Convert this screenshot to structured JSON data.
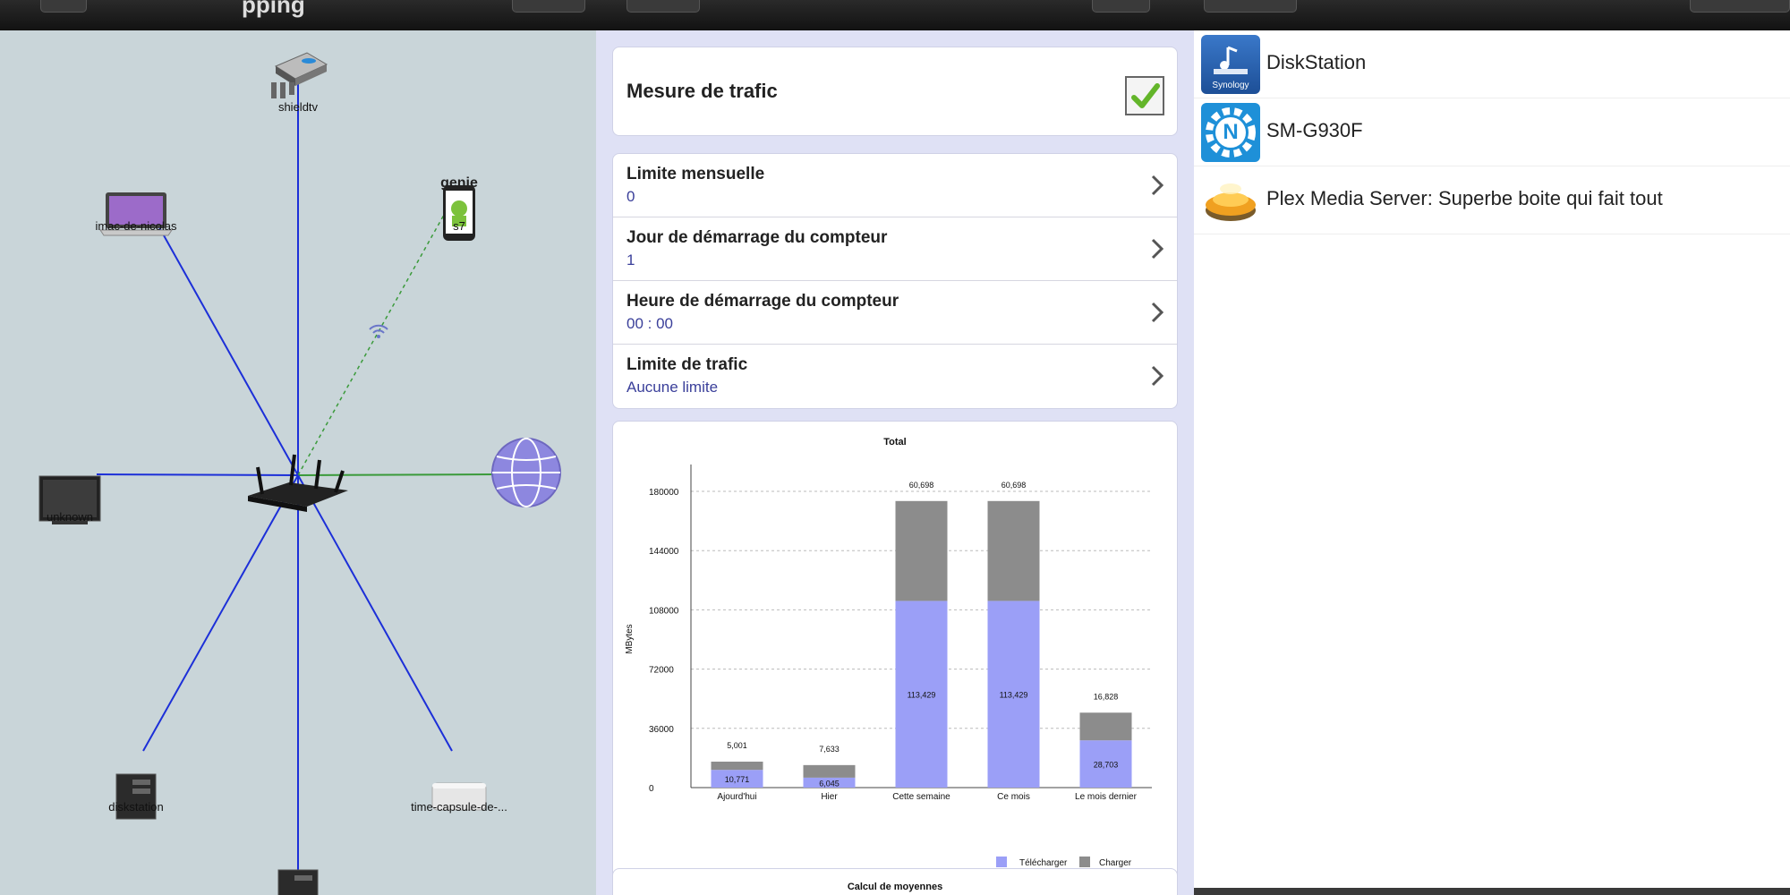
{
  "topbar": {
    "title": "pping"
  },
  "map": {
    "nodes": [
      {
        "id": "shieldtv",
        "label": "shieldtv"
      },
      {
        "id": "imac",
        "label": "imac-de-nicolas"
      },
      {
        "id": "s7",
        "label": "s7",
        "badge": "genie"
      },
      {
        "id": "unknown",
        "label": "unknown"
      },
      {
        "id": "diskstation",
        "label": "diskstation"
      },
      {
        "id": "timecapsule",
        "label": "time-capsule-de-..."
      }
    ]
  },
  "settings": {
    "traffic_meter": {
      "label": "Mesure de trafic",
      "checked": true
    },
    "rows": [
      {
        "label": "Limite mensuelle",
        "value": "0"
      },
      {
        "label": "Jour de démarrage du compteur",
        "value": "1"
      },
      {
        "label": "Heure de démarrage du compteur",
        "value": "00 : 00"
      },
      {
        "label": "Limite de trafic",
        "value": "Aucune limite"
      }
    ],
    "next_card_title": "Calcul de moyennes"
  },
  "chart_data": {
    "type": "bar",
    "stacked": true,
    "title": "Total",
    "ylabel": "MBytes",
    "xlabel": "",
    "ylim": [
      0,
      180000
    ],
    "yticks": [
      0,
      36000,
      72000,
      108000,
      144000,
      180000
    ],
    "ytick_labels": [
      "0",
      "36000",
      "72000",
      "108000",
      "144000",
      "180000"
    ],
    "categories": [
      "Ajourd'hui",
      "Hier",
      "Cette semaine",
      "Ce mois",
      "Le mois dernier"
    ],
    "series": [
      {
        "name": "Télécharger",
        "color": "#9b9ff7",
        "values": [
          10771,
          6045,
          113429,
          113429,
          28703
        ],
        "labels": [
          "10,771",
          "6,045",
          "113,429",
          "113,429",
          "28,703"
        ]
      },
      {
        "name": "Charger",
        "color": "#8c8c8c",
        "values": [
          5001,
          7633,
          60698,
          60698,
          16828
        ],
        "labels": [
          "5,001",
          "7,633",
          "60,698",
          "60,698",
          "16,828"
        ]
      }
    ],
    "grid": true,
    "legend": "bottom-right"
  },
  "apps": [
    {
      "name": "DiskStation",
      "icon": "synology-icon",
      "icon_text": "Synology"
    },
    {
      "name": "SM-G930F",
      "icon": "nas-settings-icon",
      "icon_text": "N"
    },
    {
      "name": "Plex Media Server: Superbe boite qui fait tout",
      "icon": "plex-icon"
    }
  ],
  "colors": {
    "wired": "#1c2fd8",
    "wireless": "#3a9a3a",
    "accent": "#3a3f9a"
  }
}
